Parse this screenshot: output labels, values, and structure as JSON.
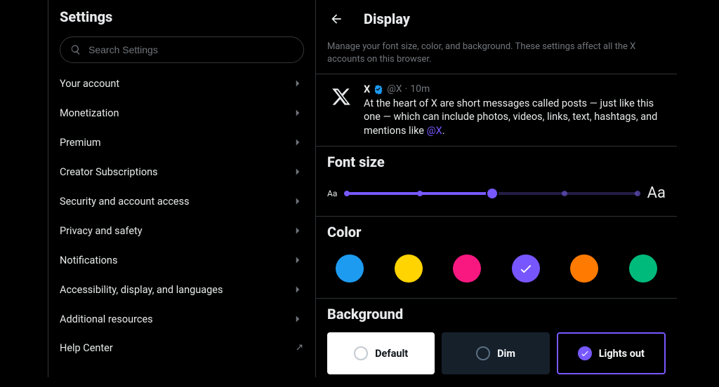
{
  "sidebar": {
    "title": "Settings",
    "search_placeholder": "Search Settings",
    "items": [
      {
        "label": "Your account",
        "external": false
      },
      {
        "label": "Monetization",
        "external": false
      },
      {
        "label": "Premium",
        "external": false
      },
      {
        "label": "Creator Subscriptions",
        "external": false
      },
      {
        "label": "Security and account access",
        "external": false
      },
      {
        "label": "Privacy and safety",
        "external": false
      },
      {
        "label": "Notifications",
        "external": false
      },
      {
        "label": "Accessibility, display, and languages",
        "external": false
      },
      {
        "label": "Additional resources",
        "external": false
      },
      {
        "label": "Help Center",
        "external": true
      }
    ]
  },
  "main": {
    "title": "Display",
    "subtitle": "Manage your font size, color, and background. These settings affect all the X accounts on this browser.",
    "sample_post": {
      "author": "X",
      "handle": "@X",
      "timestamp": "10m",
      "text_part1": "At the heart of X are short messages called posts — just like this one — which can include photos, videos, links, text, hashtags, and mentions like ",
      "mention": "@X",
      "text_part2": "."
    },
    "font_size": {
      "title": "Font size",
      "label_small": "Aa",
      "label_large": "Aa",
      "steps": 5,
      "selected_index": 2
    },
    "color": {
      "title": "Color",
      "options": [
        {
          "name": "blue",
          "hex": "#1d9bf0",
          "selected": false
        },
        {
          "name": "yellow",
          "hex": "#ffd400",
          "selected": false
        },
        {
          "name": "pink",
          "hex": "#f91880",
          "selected": false
        },
        {
          "name": "purple",
          "hex": "#7856ff",
          "selected": true
        },
        {
          "name": "orange",
          "hex": "#ff7a00",
          "selected": false
        },
        {
          "name": "green",
          "hex": "#00ba7c",
          "selected": false
        }
      ]
    },
    "background": {
      "title": "Background",
      "options": [
        {
          "label": "Default",
          "selected": false
        },
        {
          "label": "Dim",
          "selected": false
        },
        {
          "label": "Lights out",
          "selected": true
        }
      ]
    }
  }
}
